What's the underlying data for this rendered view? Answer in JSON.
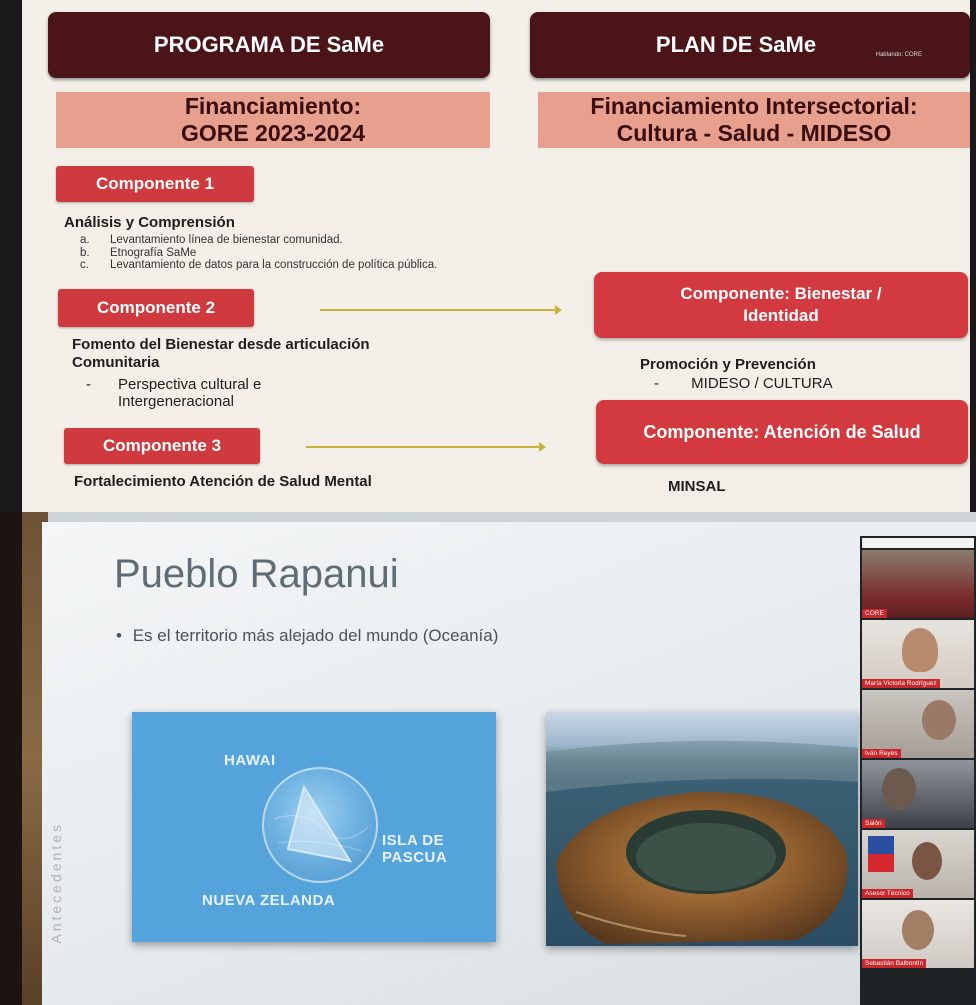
{
  "top_slide": {
    "programa_header": "PROGRAMA DE SaMe",
    "plan_header": "PLAN  DE SaMe",
    "plan_header_tag": "Hablando: CORE",
    "financiamiento_left": [
      "Financiamiento:",
      "GORE 2023-2024"
    ],
    "financiamiento_right": [
      "Financiamiento Intersectorial:",
      "Cultura - Salud - MIDESO"
    ],
    "componente1": {
      "label": "Componente 1",
      "title": "Análisis y Comprensión",
      "items": [
        {
          "marker": "a.",
          "text": "Levantamiento línea de bienestar comunidad."
        },
        {
          "marker": "b.",
          "text": "Etnografía SaMe"
        },
        {
          "marker": "c.",
          "text": "Levantamiento de datos para la construcción de política pública."
        }
      ]
    },
    "componente2": {
      "label": "Componente 2",
      "title": [
        "Fomento del Bienestar desde articulación",
        "Comunitaria"
      ],
      "bullet_marker": "-",
      "bullet_lines": [
        "Perspectiva cultural e",
        "Intergeneracional"
      ]
    },
    "componente3": {
      "label": "Componente 3",
      "title": "Fortalecimiento Atención de Salud Mental"
    },
    "plan_comp_bienestar": {
      "label": [
        "Componente: Bienestar /",
        "Identidad"
      ],
      "title": "Promoción y Prevención",
      "bullet_marker": "-",
      "bullet": "MIDESO / CULTURA"
    },
    "plan_comp_salud": {
      "label": "Componente: Atención de Salud",
      "title": "MINSAL"
    }
  },
  "bottom_slide": {
    "title": "Pueblo Rapanui",
    "bullet_marker": "•",
    "bullet": "Es el territorio más alejado del mundo (Oceanía)",
    "side_label": "Antecedentes",
    "map_labels": {
      "hawai": "HAWAI",
      "isla": "ISLA DE PASCUA",
      "nz": "NUEVA ZELANDA"
    },
    "participants": [
      {
        "name": "CORE"
      },
      {
        "name": "María Victoria Rodríguez"
      },
      {
        "name": "Iván Reyes"
      },
      {
        "name": "Salón"
      },
      {
        "name": "Asesor Técnico"
      },
      {
        "name": "Sebastián Balbontín"
      }
    ]
  },
  "colors": {
    "header_dark": "#4a1418",
    "peach": "#e7a08e",
    "component_red": "#cf3a3f",
    "arrow_yellow": "#c9b23a",
    "map_blue": "#54a3db"
  }
}
